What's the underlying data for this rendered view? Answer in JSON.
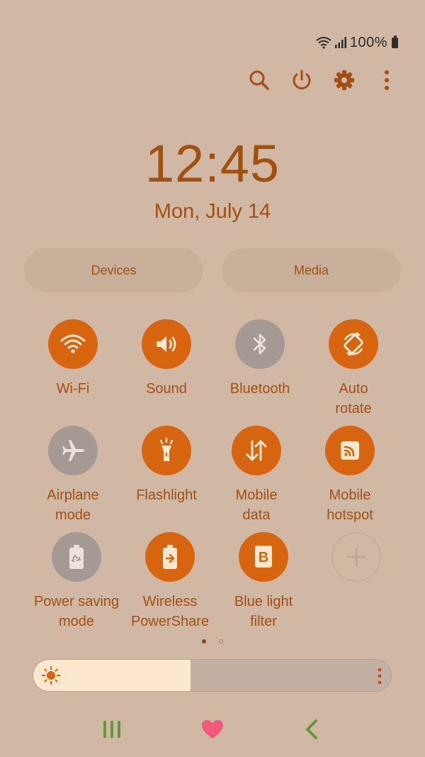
{
  "status": {
    "battery_pct": "100%"
  },
  "top_actions": [
    {
      "icon": "search-icon"
    },
    {
      "icon": "power-icon"
    },
    {
      "icon": "gear-icon"
    },
    {
      "icon": "more-vert-icon"
    }
  ],
  "clock": {
    "time": "12:45",
    "date": "Mon, July 14"
  },
  "pills": {
    "devices": "Devices",
    "media": "Media"
  },
  "tiles": [
    {
      "label_lines": [
        "Wi-Fi"
      ],
      "state": "on",
      "icon": "wifi-icon"
    },
    {
      "label_lines": [
        "Sound"
      ],
      "state": "on",
      "icon": "sound-icon"
    },
    {
      "label_lines": [
        "Bluetooth"
      ],
      "state": "off",
      "icon": "bluetooth-icon"
    },
    {
      "label_lines": [
        "Auto",
        "rotate"
      ],
      "state": "on",
      "icon": "rotate-icon"
    },
    {
      "label_lines": [
        "Airplane",
        "mode"
      ],
      "state": "off",
      "icon": "airplane-icon"
    },
    {
      "label_lines": [
        "Flashlight"
      ],
      "state": "on",
      "icon": "flashlight-icon"
    },
    {
      "label_lines": [
        "Mobile",
        "data"
      ],
      "state": "on",
      "icon": "mobile-data-icon"
    },
    {
      "label_lines": [
        "Mobile",
        "hotspot"
      ],
      "state": "on",
      "icon": "hotspot-icon"
    },
    {
      "label_lines": [
        "Power saving",
        "mode"
      ],
      "state": "off",
      "icon": "power-saving-icon"
    },
    {
      "label_lines": [
        "Wireless",
        "PowerShare"
      ],
      "state": "on",
      "icon": "wireless-powershare-icon"
    },
    {
      "label_lines": [
        "Blue light",
        "filter"
      ],
      "state": "on",
      "icon": "blue-light-filter-icon"
    }
  ],
  "pager": {
    "pages": 2,
    "current": 1
  },
  "brightness": {
    "level": 0.44
  },
  "colors": {
    "accent": "#d7650f",
    "background": "#d0b8a5",
    "inactive": "#a59a93"
  },
  "nav": [
    {
      "icon": "recent-apps-icon"
    },
    {
      "icon": "heart-icon"
    },
    {
      "icon": "back-icon"
    }
  ]
}
